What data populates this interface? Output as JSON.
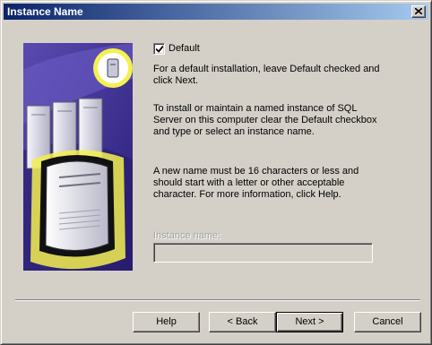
{
  "window": {
    "title": "Instance Name"
  },
  "default_option": {
    "label": "Default",
    "checked": true
  },
  "paragraphs": [
    "For a default installation, leave Default checked and\nclick Next.",
    "To install or maintain a named instance of SQL\nServer on this computer clear the Default checkbox\nand type or select an instance name.",
    "A new name must be 16 characters or less and\nshould start with a letter or other acceptable\ncharacter.  For more information, click Help."
  ],
  "instance_name": {
    "label": "Instance name:",
    "value": "",
    "enabled": false
  },
  "buttons": {
    "help": "Help",
    "back": "< Back",
    "next": "Next >",
    "cancel": "Cancel"
  },
  "icons": {
    "close": "close-icon",
    "artwork": "server-computers-illustration",
    "badge": "server-badge-icon"
  },
  "colors": {
    "face": "#d4d0c8",
    "title_start": "#0a246a",
    "title_end": "#a6caf0",
    "art_purple": "#3c2c8c",
    "art_glow": "#f4f050"
  }
}
